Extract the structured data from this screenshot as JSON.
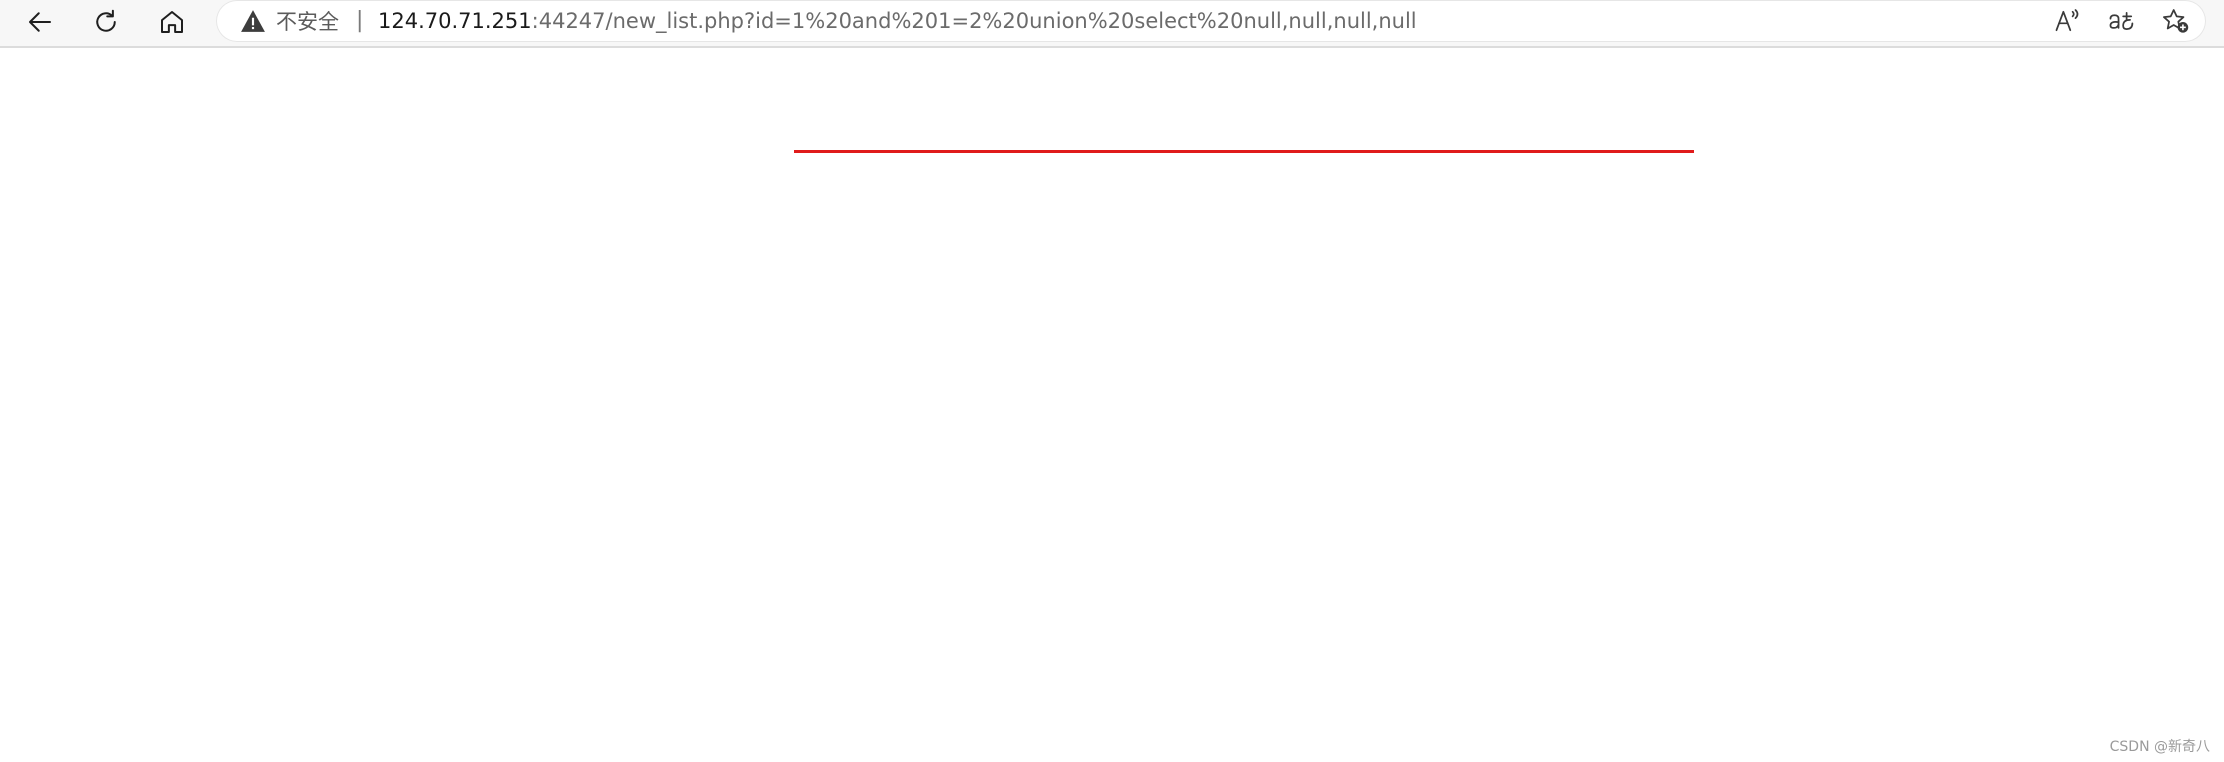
{
  "browser": {
    "security_label": "不安全",
    "separator": "|",
    "url_host": "124.70.71.251",
    "url_rest": ":44247/new_list.php?id=1%20and%201=2%20union%20select%20null,null,null,null"
  },
  "icons": {
    "back": "back-arrow-icon",
    "refresh": "refresh-icon",
    "home": "home-icon",
    "warning": "warning-icon",
    "read_aloud": "read-aloud-icon",
    "translate": "translate-icon",
    "favorites": "add-favorite-icon"
  },
  "content": {
    "divider_color": "#e01b1b"
  },
  "watermark": "CSDN @新奇八"
}
